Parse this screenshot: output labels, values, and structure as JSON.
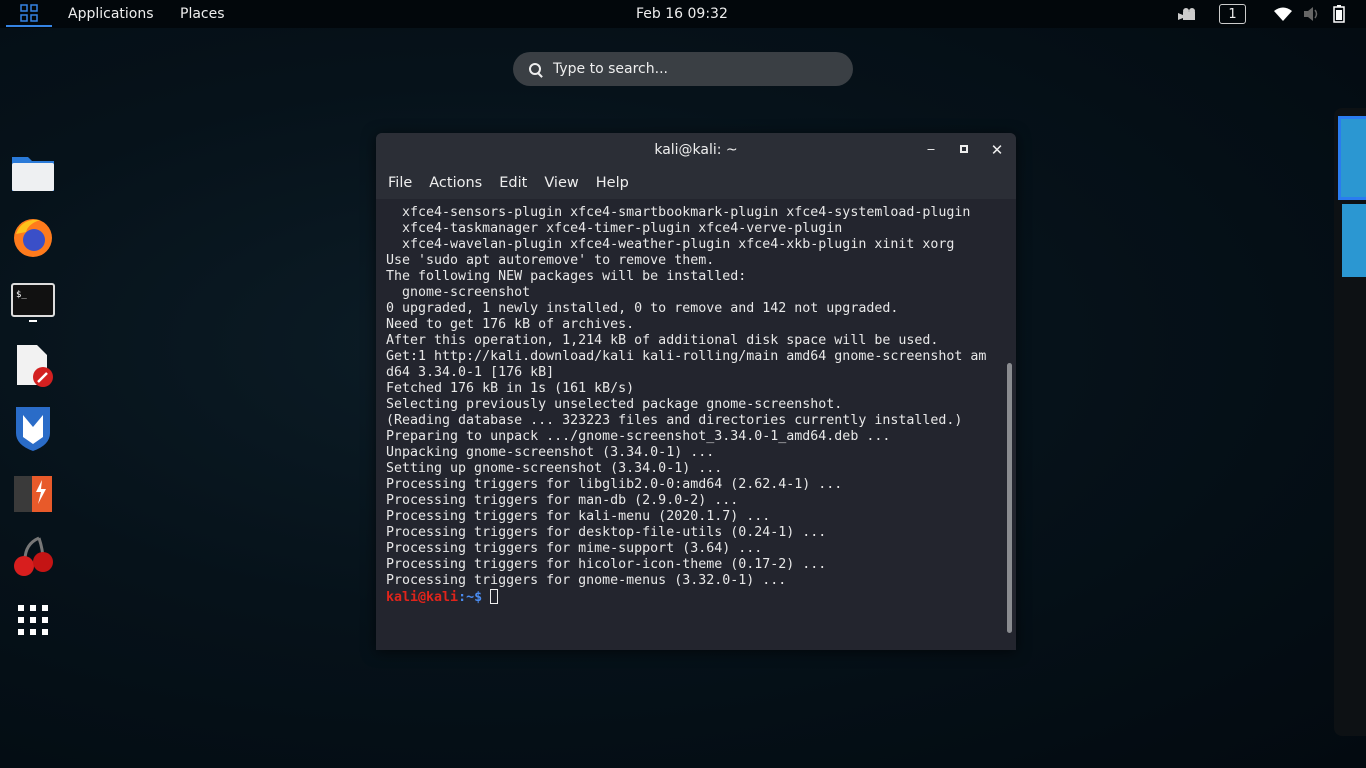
{
  "topbar": {
    "activities_icon": "apps-grid-icon",
    "applications": "Applications",
    "places": "Places",
    "clock": "Feb 16  09:32",
    "workspace_indicator": "1",
    "icons": [
      "screencast-icon",
      "wifi-icon",
      "volume-icon",
      "battery-icon"
    ]
  },
  "search": {
    "placeholder": "Type to search..."
  },
  "dock": [
    "files-icon",
    "firefox-icon",
    "terminal-icon",
    "text-editor-icon",
    "metasploit-icon",
    "burpsuite-icon",
    "cherrytree-icon",
    "show-apps-icon"
  ],
  "terminal": {
    "title": "kali@kali: ~",
    "menu": [
      "File",
      "Actions",
      "Edit",
      "View",
      "Help"
    ],
    "lines": [
      "  xfce4-sensors-plugin xfce4-smartbookmark-plugin xfce4-systemload-plugin",
      "  xfce4-taskmanager xfce4-timer-plugin xfce4-verve-plugin",
      "  xfce4-wavelan-plugin xfce4-weather-plugin xfce4-xkb-plugin xinit xorg",
      "Use 'sudo apt autoremove' to remove them.",
      "The following NEW packages will be installed:",
      "  gnome-screenshot",
      "0 upgraded, 1 newly installed, 0 to remove and 142 not upgraded.",
      "Need to get 176 kB of archives.",
      "After this operation, 1,214 kB of additional disk space will be used.",
      "Get:1 http://kali.download/kali kali-rolling/main amd64 gnome-screenshot am",
      "d64 3.34.0-1 [176 kB]",
      "Fetched 176 kB in 1s (161 kB/s)",
      "Selecting previously unselected package gnome-screenshot.",
      "(Reading database ... 323223 files and directories currently installed.)",
      "Preparing to unpack .../gnome-screenshot_3.34.0-1_amd64.deb ...",
      "Unpacking gnome-screenshot (3.34.0-1) ...",
      "Setting up gnome-screenshot (3.34.0-1) ...",
      "Processing triggers for libglib2.0-0:amd64 (2.62.4-1) ...",
      "Processing triggers for man-db (2.9.0-2) ...",
      "Processing triggers for kali-menu (2020.1.7) ...",
      "Processing triggers for desktop-file-utils (0.24-1) ...",
      "Processing triggers for mime-support (3.64) ...",
      "Processing triggers for hicolor-icon-theme (0.17-2) ...",
      "Processing triggers for gnome-menus (3.32.0-1) ..."
    ],
    "prompt_user": "kali@kali",
    "prompt_path": ":~$ "
  }
}
